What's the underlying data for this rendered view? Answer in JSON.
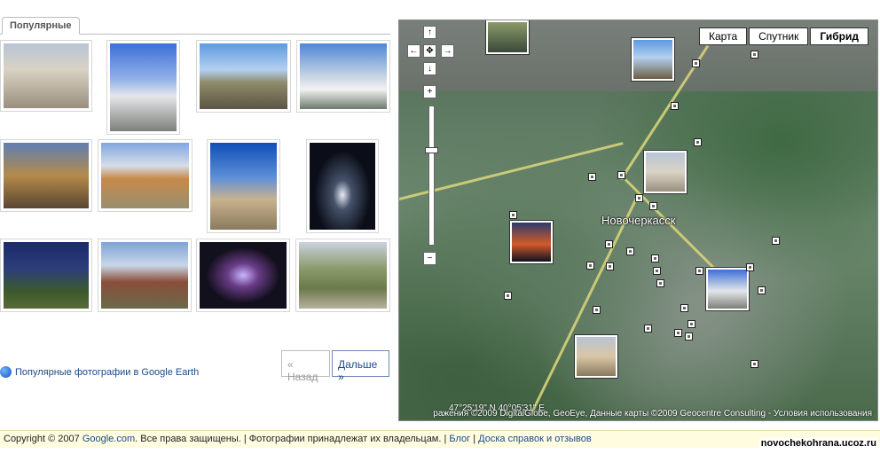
{
  "tab": {
    "label": "Популярные"
  },
  "left": {
    "pager": {
      "prev_label": "« Назад",
      "next_label": "Дальше »"
    },
    "ge_link": "Популярные фотографии в Google Earth"
  },
  "map": {
    "types": [
      "Карта",
      "Спутник",
      "Гибрид"
    ],
    "active_type": "Гибрид",
    "city_label": "Новочеркасск",
    "coords": "47°25'19\" N 40°05'31\" E",
    "copyright": "ражения ©2009 DigitalGlobe, GeoEye, Данные карты ©2009 Geocentre Consulting - Условия использования",
    "nav": {
      "up": "↑",
      "left": "←",
      "center": "✥",
      "right": "→",
      "down": "↓",
      "zoom_in": "+",
      "zoom_out": "−"
    }
  },
  "footer": {
    "copyright_prefix": "Copyright © 2007 ",
    "copyright_link": "Google.com",
    "copyright_rest": ". Все права защищены. | Фотографии принадлежат их владельцам. | ",
    "blog": "Блог",
    "sep": " | ",
    "help": "Доска справок и отзывов"
  },
  "watermark": "novochekohrana.ucoz.ru",
  "colors": {
    "link": "#1a4a8a",
    "footer_bg": "#fffce0"
  }
}
